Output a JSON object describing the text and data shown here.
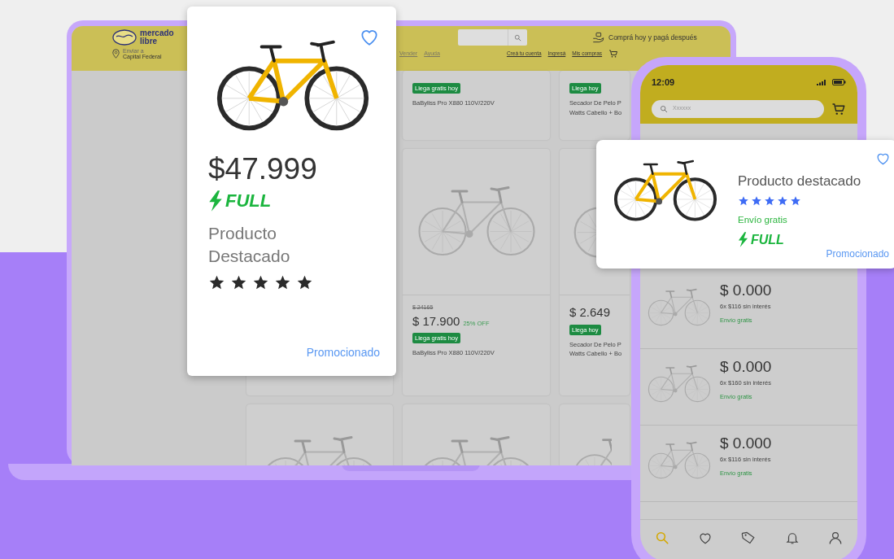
{
  "laptop": {
    "header": {
      "logo": "mercado libre",
      "location_label": "Enviar a",
      "location": "Capital Federal",
      "promo": "Comprá hoy y pagá después",
      "nav_left": [
        "Vender",
        "Ayuda"
      ],
      "nav_right": [
        "Creá tu cuenta",
        "Ingresá",
        "Mis compras"
      ]
    },
    "products": [
      {
        "kind": "text",
        "badge": "Llega gratis hoy",
        "title": "BaByliss Pro X880 110V/220V"
      },
      {
        "kind": "text",
        "badge": "Llega hoy",
        "title": "Secador De Pelo P\nWatts Cabello + Bo"
      },
      {
        "kind": "plain"
      },
      {
        "kind": "bike",
        "old_price": "$ 24165",
        "price": "$ 17.900",
        "discount": "25% OFF",
        "badge": "Llega gratis hoy",
        "title": "BaByliss Pro X880 110V/220V"
      },
      {
        "kind": "bike",
        "price": "$ 2.649",
        "badge": "Llega hoy",
        "title": "Secador De Pelo P\nWatts Cabello + Bo"
      },
      {
        "kind": "bike"
      },
      {
        "kind": "bike"
      },
      {
        "kind": "bike"
      }
    ]
  },
  "featured_card": {
    "price": "$47.999",
    "shipping": "FULL",
    "title": "Producto\nDestacado",
    "stars": 5,
    "sponsored": "Promocionado"
  },
  "phone": {
    "time": "12:09",
    "search_placeholder": "Xxxxxx",
    "items": [
      {
        "price": "$ 0.000",
        "installments": "6x $116 sin interés",
        "shipping": "Envío gratis"
      },
      {
        "price": "$ 0.000",
        "installments": "6x $160 sin interés",
        "shipping": "Envío gratis"
      },
      {
        "price": "$ 0.000",
        "installments": "6x $116 sin interés",
        "shipping": "Envío gratis"
      }
    ],
    "tabs": [
      {
        "kind": "search",
        "selected": true
      },
      {
        "kind": "heart",
        "selected": false
      },
      {
        "kind": "tag",
        "selected": false
      },
      {
        "kind": "bell",
        "selected": false
      },
      {
        "kind": "user",
        "selected": false
      }
    ]
  },
  "phone_featured_card": {
    "title": "Producto destacado",
    "stars": 5,
    "free_shipping": "Envío gratis",
    "shipping": "FULL",
    "sponsored": "Promocionado"
  }
}
